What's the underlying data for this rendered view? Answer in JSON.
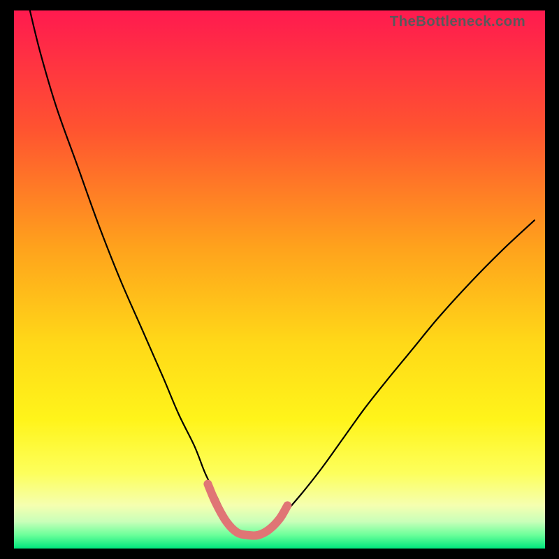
{
  "watermark": "TheBottleneck.com",
  "chart_data": {
    "type": "line",
    "title": "",
    "xlabel": "",
    "ylabel": "",
    "xlim": [
      0,
      100
    ],
    "ylim": [
      0,
      100
    ],
    "series": [
      {
        "name": "bottleneck-curve",
        "x": [
          3,
          5,
          8,
          12,
          16,
          20,
          24,
          28,
          31,
          34,
          36,
          38,
          40,
          42,
          44,
          46,
          48,
          50,
          54,
          58,
          62,
          66,
          70,
          75,
          80,
          86,
          92,
          98
        ],
        "values": [
          100,
          92,
          82,
          71,
          60,
          50,
          41,
          32,
          25,
          19,
          14,
          10,
          6,
          3.5,
          2.5,
          2.5,
          3.5,
          5.5,
          10,
          15,
          20.5,
          26,
          31,
          37,
          43,
          49.5,
          55.5,
          61
        ],
        "color": "#000000"
      },
      {
        "name": "highlight-segment",
        "x": [
          36.5,
          38,
          40,
          42,
          44,
          46,
          48,
          50,
          51.5
        ],
        "values": [
          12,
          8.5,
          5,
          3,
          2.5,
          2.5,
          3.5,
          5.5,
          8
        ],
        "color": "#e07575"
      }
    ],
    "gradient_bands": [
      {
        "y": 100,
        "color": "#ff1a4f"
      },
      {
        "y": 78,
        "color": "#ff5330"
      },
      {
        "y": 56,
        "color": "#ffa21c"
      },
      {
        "y": 38,
        "color": "#ffd918"
      },
      {
        "y": 24,
        "color": "#fff41a"
      },
      {
        "y": 14,
        "color": "#fdff5c"
      },
      {
        "y": 8,
        "color": "#f5ffb0"
      },
      {
        "y": 5,
        "color": "#c9ffb9"
      },
      {
        "y": 2.5,
        "color": "#6bff9a"
      },
      {
        "y": 0,
        "color": "#00e67d"
      }
    ]
  }
}
